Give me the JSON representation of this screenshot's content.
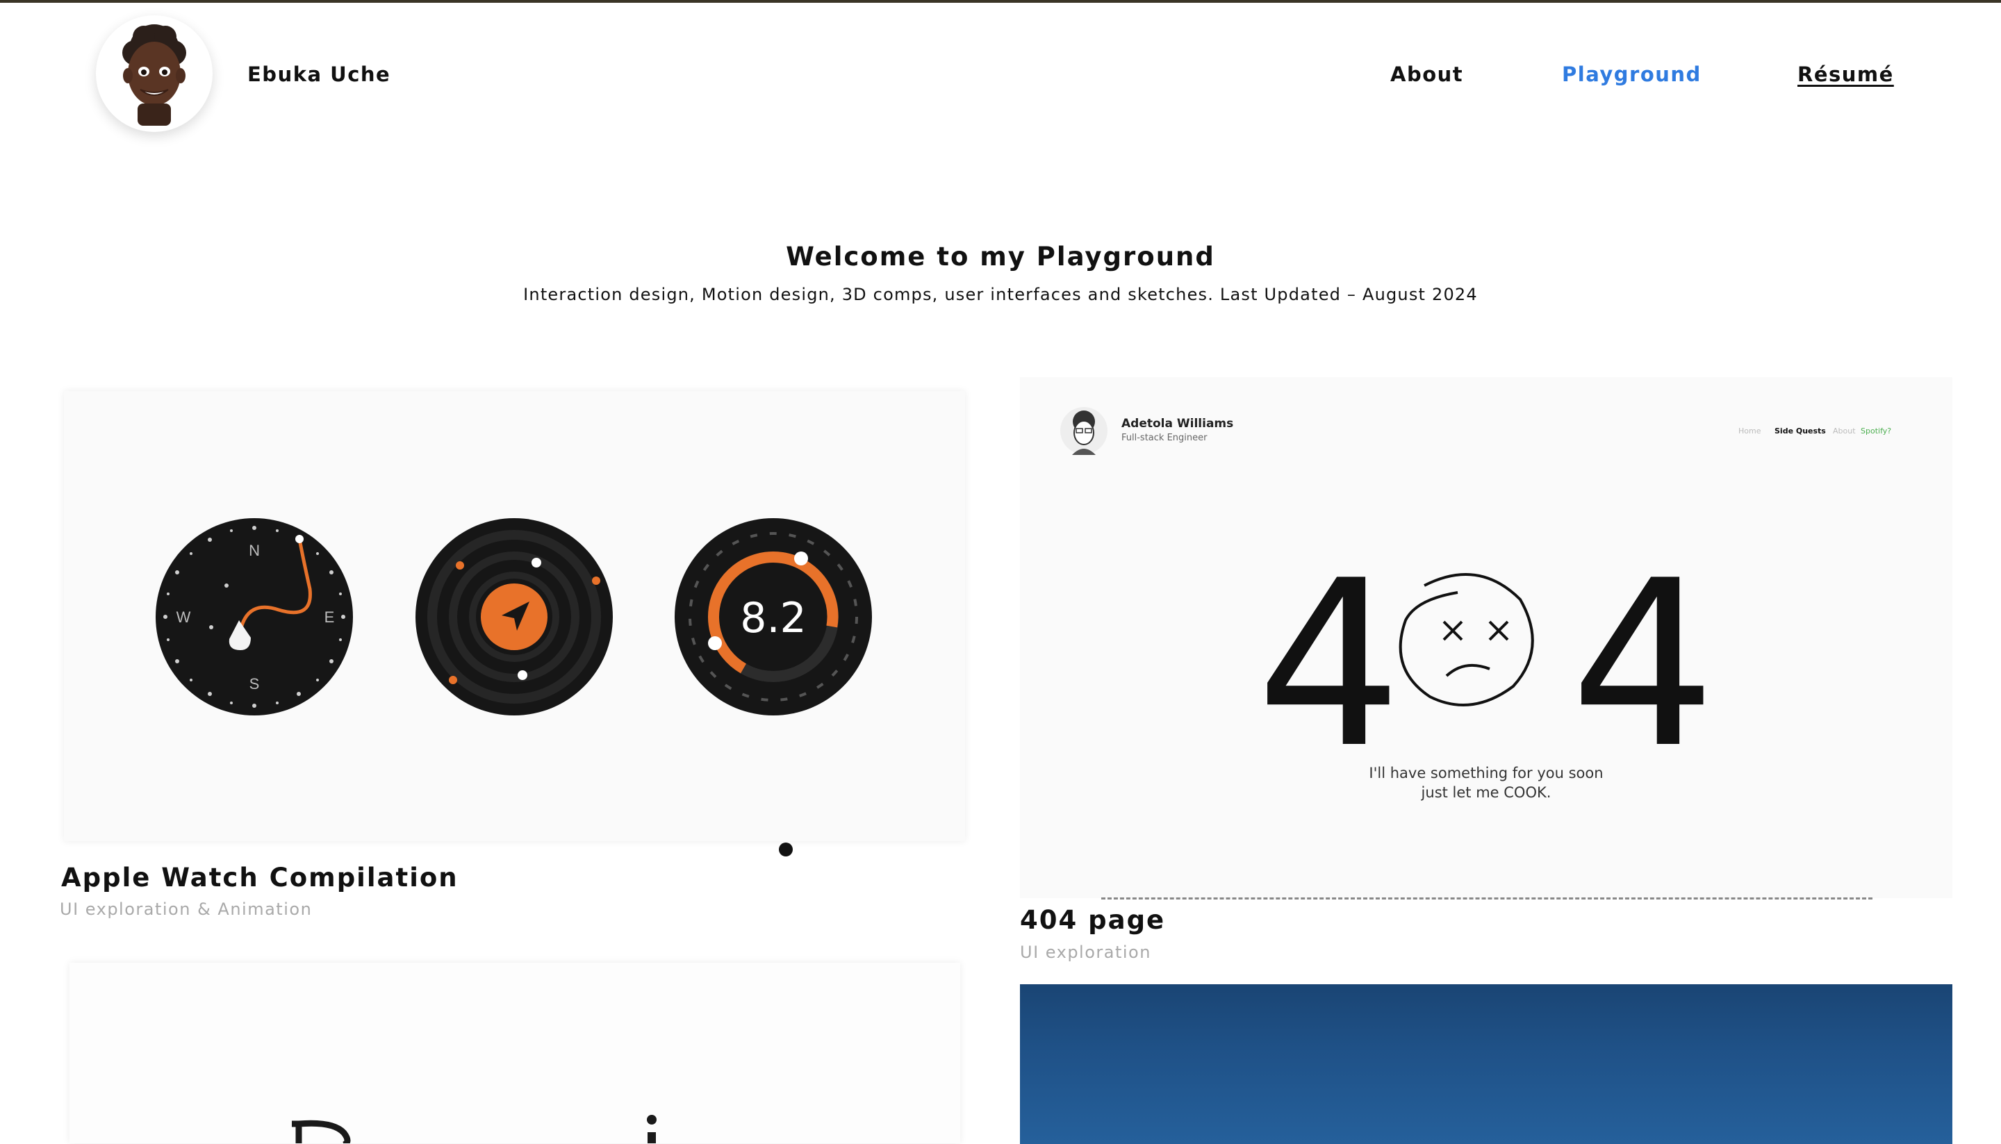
{
  "header": {
    "site_name": "Ebuka Uche",
    "nav": {
      "about": "About",
      "playground": "Playground",
      "resume": "Résumé"
    }
  },
  "hero": {
    "title": "Welcome to my Playground",
    "subtitle": "Interaction design, Motion design, 3D comps, user interfaces and sketches. Last Updated – August 2024"
  },
  "projects": [
    {
      "title": "Apple Watch Compilation",
      "tags": "UI exploration & Animation",
      "watch": {
        "compass_letters": [
          "N",
          "E",
          "S",
          "W"
        ],
        "score": "8.2"
      }
    },
    {
      "title": "404 page",
      "tags": "UI exploration",
      "mock": {
        "name": "Adetola Williams",
        "role": "Full-stack Engineer",
        "nav": [
          "Home",
          "Side Quests",
          "About",
          "Spotify?"
        ],
        "big_digits": [
          "4",
          "4"
        ],
        "message_line1": "I'll have something for you soon",
        "message_line2": "just let me COOK."
      }
    }
  ],
  "colors": {
    "accent_blue": "#2f7be0",
    "watch_orange": "#e8722a",
    "watch_dark": "#161616",
    "tile_blue": "#1f5187"
  },
  "icons": [
    "avatar-memoji-icon",
    "compass-icon",
    "navigation-arrow-icon",
    "sad-face-icon"
  ]
}
